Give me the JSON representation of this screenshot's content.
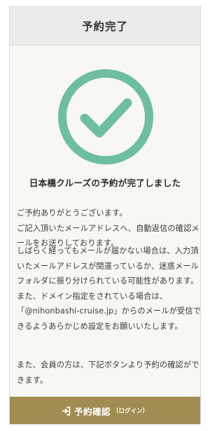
{
  "colors": {
    "accent_green": "#6dbf9e",
    "button_gold": "#a18d52",
    "card_bg": "#f8f7f3",
    "header_bg": "#ebebe9"
  },
  "header": {
    "title": "予約完了"
  },
  "status": {
    "icon": "check-circle-icon",
    "headline": "日本橋クルーズの予約が完了しました"
  },
  "message": {
    "paragraph1": [
      "ご予約ありがとうございます。",
      "ご記入頂いたメールアドレスへ、自動返信の確認メ",
      "ールをお送りしております。"
    ],
    "paragraph2": [
      "しばらく経ってもメールが届かない場合は、入力頂",
      "いたメールアドレスが間違っているか、迷惑メール",
      "フォルダに振り分けられている可能性があります。",
      "また、ドメイン指定をされている場合は、",
      "「@nihonbashi-cruise.jp」からのメールが受信で",
      "きるようあらかじめ設定をお願いいたします。"
    ],
    "paragraph3": [
      "また、会員の方は、下記ボタンより予約の確認がで",
      "きます。"
    ]
  },
  "cta": {
    "icon": "login-icon",
    "label": "予約確認",
    "sub_label": "（ログイン）"
  }
}
